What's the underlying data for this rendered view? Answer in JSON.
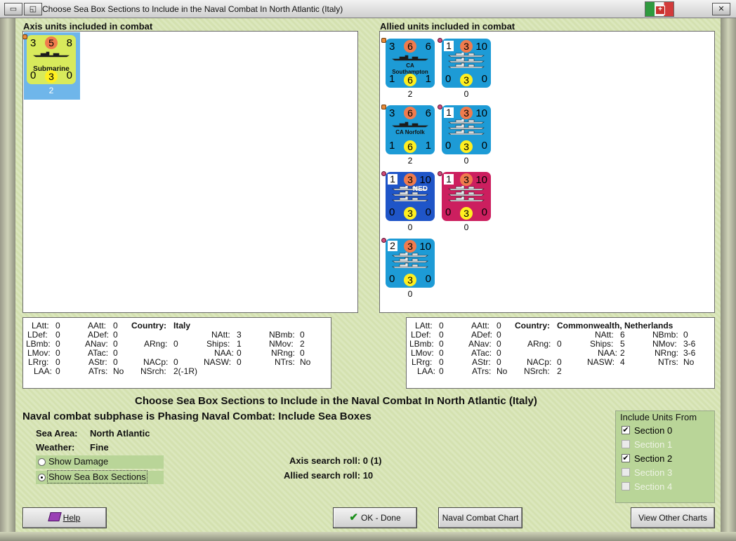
{
  "window": {
    "title": "Choose Sea Box Sections to Include in the Naval Combat In North Atlantic (Italy)"
  },
  "axis": {
    "header": "Axis units included in combat",
    "units": [
      {
        "top_left": "3",
        "top_mid": "5",
        "top_right": "8",
        "name": "Submarine",
        "bot_left": "0",
        "bot_mid": "3",
        "bot_right": "0",
        "count": "2",
        "color": "#d8ea5c"
      }
    ]
  },
  "allied": {
    "header": "Allied units included in combat",
    "units": [
      {
        "top_left": "3",
        "top_mid": "6",
        "top_right": "6",
        "name": "CA\nSouthampton",
        "bot_left": "1",
        "bot_mid": "6",
        "bot_right": "1",
        "count": "2",
        "color": "#1d9bd6"
      },
      {
        "top_left": "1",
        "top_mid": "3",
        "top_right": "10",
        "name": "",
        "bot_left": "0",
        "bot_mid": "3",
        "bot_right": "0",
        "count": "0",
        "color": "#1d9bd6"
      },
      {
        "top_left": "3",
        "top_mid": "6",
        "top_right": "6",
        "name": "CA Norfolk",
        "bot_left": "1",
        "bot_mid": "6",
        "bot_right": "1",
        "count": "2",
        "color": "#1d9bd6"
      },
      {
        "top_left": "1",
        "top_mid": "3",
        "top_right": "10",
        "name": "",
        "bot_left": "0",
        "bot_mid": "3",
        "bot_right": "0",
        "count": "0",
        "color": "#1d9bd6"
      },
      {
        "top_left": "1",
        "top_mid": "3",
        "top_right": "10",
        "name": "NED",
        "bot_left": "0",
        "bot_mid": "3",
        "bot_right": "0",
        "count": "0",
        "color": "#1f55c8"
      },
      {
        "top_left": "1",
        "top_mid": "3",
        "top_right": "10",
        "name": "",
        "bot_left": "0",
        "bot_mid": "3",
        "bot_right": "0",
        "count": "0",
        "color": "#cc1f5f"
      },
      {
        "top_left": "2",
        "top_mid": "3",
        "top_right": "10",
        "name": "",
        "bot_left": "0",
        "bot_mid": "3",
        "bot_right": "0",
        "count": "0",
        "color": "#1d9bd6"
      }
    ]
  },
  "axis_stats": {
    "latt": "0",
    "aatt": "0",
    "country_label": "Country:",
    "country": "Italy",
    "ldef": "0",
    "adef": "0",
    "natt": "3",
    "nbmb": "0",
    "lbmb": "0",
    "anav": "0",
    "arng": "0",
    "ships": "1",
    "nmov": "2",
    "lmov": "0",
    "atac": "0",
    "naa": "0",
    "nrng": "0",
    "lrrg": "0",
    "astr": "0",
    "nacp": "0",
    "nasw": "0",
    "ntrs": "No",
    "laa": "0",
    "atrs": "No",
    "nsrch": "2(-1R)"
  },
  "allied_stats": {
    "latt": "0",
    "aatt": "0",
    "country_label": "Country:",
    "country": "Commonwealth, Netherlands",
    "ldef": "0",
    "adef": "0",
    "natt": "6",
    "nbmb": "0",
    "lbmb": "0",
    "anav": "0",
    "arng": "0",
    "ships": "5",
    "nmov": "3-6",
    "lmov": "0",
    "atac": "0",
    "naa": "2",
    "nrng": "3-6",
    "lrrg": "0",
    "astr": "0",
    "nacp": "0",
    "nasw": "4",
    "ntrs": "No",
    "laa": "0",
    "atrs": "No",
    "nsrch": "2"
  },
  "labels": {
    "latt": "LAtt:",
    "aatt": "AAtt:",
    "ldef": "LDef:",
    "adef": "ADef:",
    "natt": "NAtt:",
    "nbmb": "NBmb:",
    "lbmb": "LBmb:",
    "anav": "ANav:",
    "arng": "ARng:",
    "ships": "Ships:",
    "nmov": "NMov:",
    "lmov": "LMov:",
    "atac": "ATac:",
    "naa": "NAA:",
    "nrng": "NRng:",
    "lrrg": "LRrg:",
    "astr": "AStr:",
    "nacp": "NACp:",
    "nasw": "NASW:",
    "ntrs": "NTrs:",
    "laa": "LAA:",
    "atrs": "ATrs:",
    "nsrch": "NSrch:"
  },
  "main": {
    "heading": "Choose Sea Box Sections to Include in the Naval Combat In North Atlantic (Italy)",
    "subphase": "Naval combat subphase is Phasing Naval Combat: Include Sea Boxes",
    "sea_area_label": "Sea Area:",
    "sea_area": "North Atlantic",
    "weather_label": "Weather:",
    "weather": "Fine",
    "show_damage": "Show Damage",
    "show_sections": "Show Sea Box Sections",
    "axis_roll": "Axis search roll: 0 (1)",
    "allied_roll": "Allied search roll: 10"
  },
  "include": {
    "title": "Include Units From",
    "sections": [
      {
        "label": "Section 0",
        "checked": true,
        "enabled": true
      },
      {
        "label": "Section 1",
        "checked": false,
        "enabled": false
      },
      {
        "label": "Section 2",
        "checked": true,
        "enabled": true
      },
      {
        "label": "Section 3",
        "checked": false,
        "enabled": false
      },
      {
        "label": "Section 4",
        "checked": false,
        "enabled": false
      }
    ]
  },
  "buttons": {
    "help": "Help",
    "ok": "OK - Done",
    "chart": "Naval Combat Chart",
    "other": "View Other Charts"
  }
}
